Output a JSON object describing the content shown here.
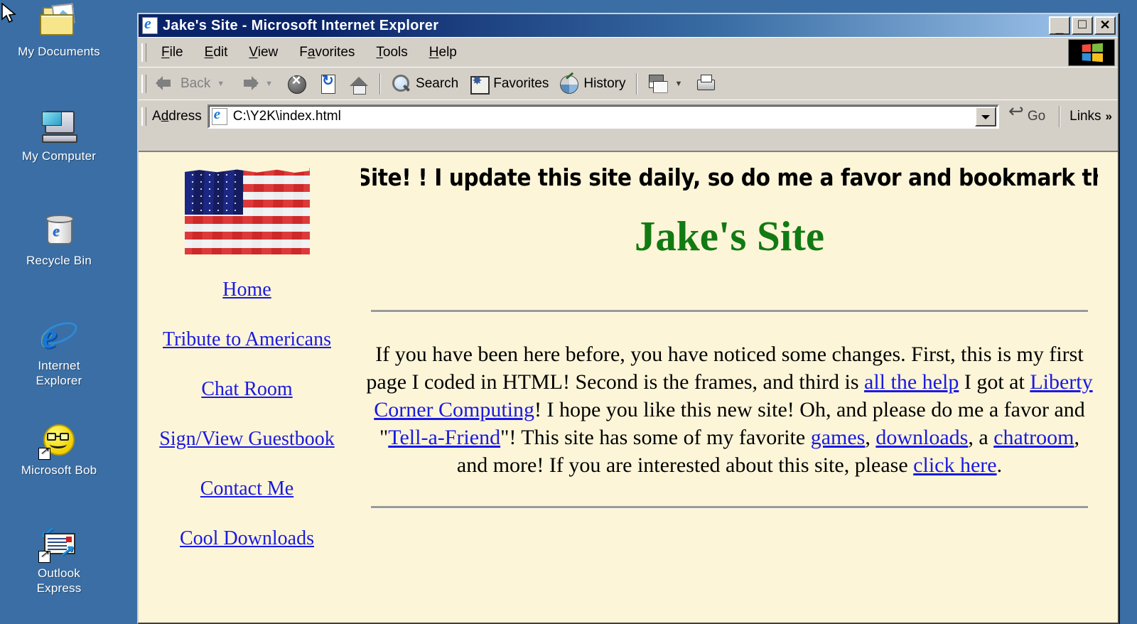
{
  "desktop": {
    "icons": [
      {
        "label": "My Documents",
        "icon": "folder-documents-icon"
      },
      {
        "label": "My Computer",
        "icon": "computer-icon"
      },
      {
        "label": "Recycle Bin",
        "icon": "recycle-bin-icon"
      },
      {
        "label": "Internet\nExplorer",
        "icon": "internet-explorer-icon"
      },
      {
        "label": "Microsoft Bob",
        "icon": "microsoft-bob-icon"
      },
      {
        "label": "Outlook\nExpress",
        "icon": "outlook-express-icon"
      }
    ],
    "background_color": "#3a6ea5",
    "cursor": "arrow-pointer"
  },
  "window": {
    "title": "Jake's Site - Microsoft Internet Explorer",
    "app_icon": "ie-page-icon",
    "controls": {
      "minimize": "_",
      "maximize": "□",
      "close": "✕"
    }
  },
  "menubar": {
    "items": [
      {
        "label": "File",
        "accel": "F"
      },
      {
        "label": "Edit",
        "accel": "E"
      },
      {
        "label": "View",
        "accel": "V"
      },
      {
        "label": "Favorites",
        "accel": "a"
      },
      {
        "label": "Tools",
        "accel": "T"
      },
      {
        "label": "Help",
        "accel": "H"
      }
    ],
    "logo": "windows-flag-logo"
  },
  "toolbar": {
    "back": {
      "label": "Back",
      "icon": "back-arrow-icon",
      "disabled": true
    },
    "forward": {
      "label": "",
      "icon": "forward-arrow-icon",
      "disabled": true
    },
    "stop": {
      "label": "",
      "icon": "stop-icon"
    },
    "refresh": {
      "label": "",
      "icon": "refresh-icon"
    },
    "home": {
      "label": "",
      "icon": "home-icon"
    },
    "search": {
      "label": "Search",
      "icon": "search-icon"
    },
    "favorites": {
      "label": "Favorites",
      "icon": "favorites-folder-icon"
    },
    "history": {
      "label": "History",
      "icon": "history-clock-icon"
    },
    "mail": {
      "label": "",
      "icon": "mail-icon"
    },
    "print": {
      "label": "",
      "icon": "printer-icon"
    }
  },
  "addressbar": {
    "label": "Address",
    "accel": "d",
    "value": "C:\\Y2K\\index.html",
    "placeholder": "C:\\Y2K\\index.html",
    "favicon": "ie-page-icon",
    "dropdown_icon": "chevron-down-icon",
    "go_label": "Go",
    "go_icon": "go-arrow-icon",
    "links_label": "Links",
    "links_chevron": "»"
  },
  "page": {
    "background_color": "#fdf5d8",
    "flag_image": "animated-us-flag-gif",
    "nav_links": [
      "Home",
      "Tribute to Americans",
      "Chat Room",
      "Sign/View Guestbook",
      "Contact Me",
      "Cool Downloads"
    ],
    "marquee": "s Site! ! I update this site daily, so do me a favor and bookmark this",
    "title": "Jake's Site",
    "title_color": "#127a12",
    "body": {
      "p1": "If you have been here before, you have noticed some changes. First, this is my first page I coded in HTML! Second is the frames, and third is ",
      "link1": "all the help",
      "p2": " I got at ",
      "link2": "Liberty Corner Computing",
      "p3": "! I hope you like this new site! Oh, and please do me a favor and \"",
      "link3": "Tell-a-Friend",
      "p4": "\"! This site has some of my favorite ",
      "link4": "games",
      "p5": ", ",
      "link5": "downloads",
      "p6": ", a ",
      "link6": "chatroom",
      "p7": ", and more! If you are interested about this site, please ",
      "link7": "click here",
      "p8": "."
    },
    "link_color": "#1a1ae0"
  }
}
